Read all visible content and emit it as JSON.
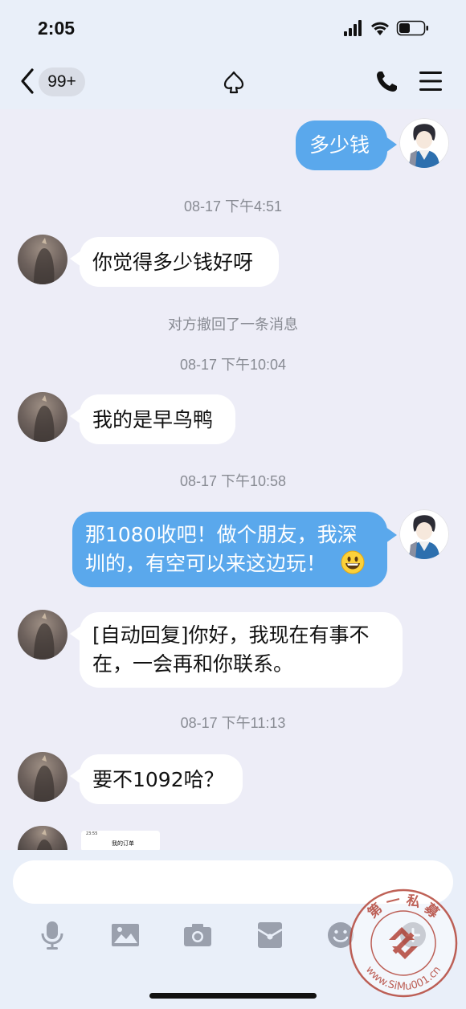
{
  "status": {
    "time": "2:05"
  },
  "nav": {
    "unread_badge": "99+"
  },
  "messages": [
    {
      "from": "me",
      "text": "多少钱"
    },
    {
      "type": "timestamp",
      "text": "08-17 下午4:51"
    },
    {
      "from": "other",
      "text": "你觉得多少钱好呀"
    },
    {
      "type": "system",
      "text": "对方撤回了一条消息"
    },
    {
      "type": "timestamp",
      "text": "08-17 下午10:04"
    },
    {
      "from": "other",
      "text": "我的是早鸟鸭"
    },
    {
      "type": "timestamp",
      "text": "08-17 下午10:58"
    },
    {
      "from": "me",
      "lines": [
        "那1080收吧！做个朋友，我深",
        "圳的，有空可以来这边玩！"
      ],
      "emoji": "grinning-face-emoji"
    },
    {
      "from": "other",
      "lines": [
        "[自动回复]你好，我现在有事不",
        "在，一会再和你联系。"
      ]
    },
    {
      "type": "timestamp",
      "text": "08-17 下午11:13"
    },
    {
      "from": "other",
      "text": "要不1092哈？"
    },
    {
      "from": "other",
      "type": "image",
      "thumb_time": "23:55",
      "thumb_title": "我的订单"
    }
  ],
  "toolbar": {
    "icons": [
      "microphone-icon",
      "image-icon",
      "camera-icon",
      "red-packet-icon",
      "emoji-icon",
      "plus-icon"
    ]
  },
  "watermark": {
    "text_top": "第 一 私 募",
    "text_bottom": "www.SiMu001.cn"
  },
  "colors": {
    "background": "#ededf7",
    "outgoing_bubble": "#5aa8ec",
    "incoming_bubble": "#ffffff",
    "watermark_red": "#b5473a"
  }
}
